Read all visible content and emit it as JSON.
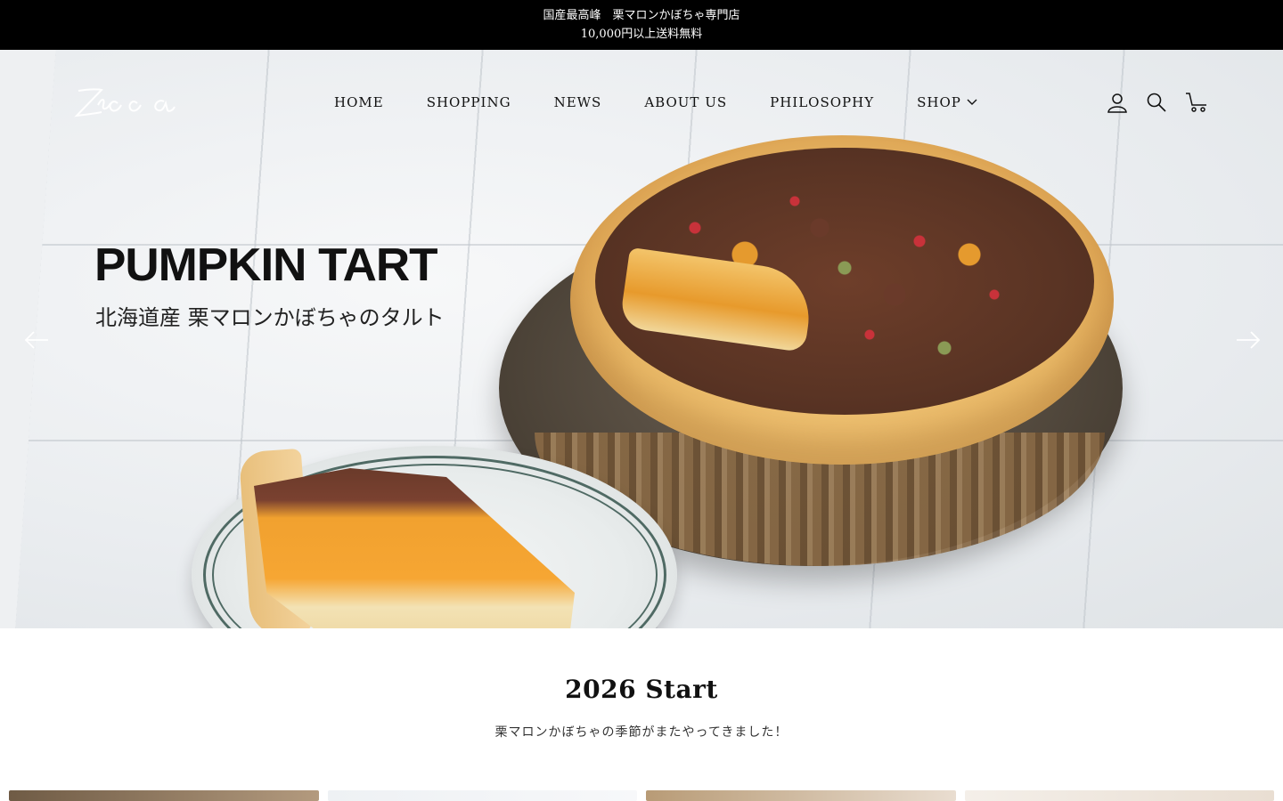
{
  "announcement": {
    "line1": "国産最高峰　栗マロンかぼちゃ専門店",
    "line2": "10,000円以上送料無料"
  },
  "header": {
    "logo_text": "Zucca",
    "nav": [
      {
        "label": "HOME"
      },
      {
        "label": "SHOPPING"
      },
      {
        "label": "NEWS"
      },
      {
        "label": "ABOUT US"
      },
      {
        "label": "PHILOSOPHY"
      },
      {
        "label": "SHOP",
        "has_dropdown": true
      }
    ],
    "icons": [
      "account-icon",
      "search-icon",
      "cart-icon"
    ]
  },
  "hero": {
    "title": "PUMPKIN TART",
    "subtitle": "北海道産 栗マロンかぼちゃのタルト"
  },
  "section": {
    "title": "2026 Start",
    "subtitle": "栗マロンかぼちゃの季節がまたやってきました！"
  },
  "colors": {
    "announcement_bg": "#000000",
    "text": "#111111"
  }
}
